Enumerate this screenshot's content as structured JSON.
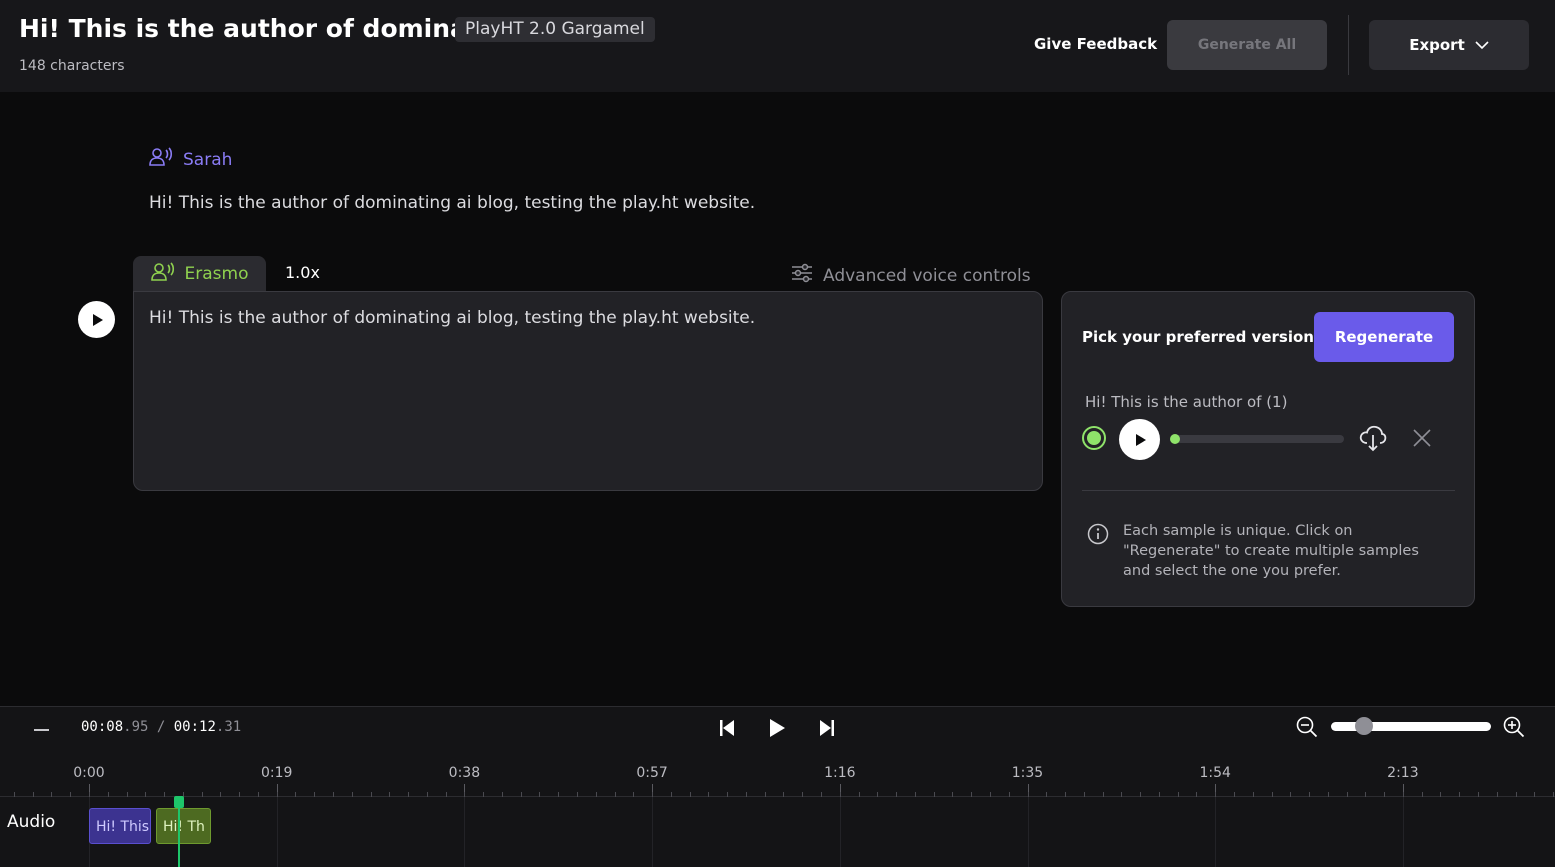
{
  "header": {
    "title": "Hi! This is the author of dominati...",
    "model": "PlayHT 2.0 Gargamel",
    "char_count": "148 characters",
    "feedback": "Give Feedback",
    "generate_all": "Generate All",
    "export": "Export"
  },
  "paragraphs": [
    {
      "speaker": "Sarah",
      "text": "Hi! This is the author of dominating ai blog, testing the play.ht website."
    },
    {
      "speaker": "Erasmo",
      "speed": "1.0x",
      "text": "Hi! This is the author of dominating ai blog, testing the play.ht website."
    }
  ],
  "advanced_controls": "Advanced voice controls",
  "versions": {
    "pick_label": "Pick your preferred version",
    "regenerate": "Regenerate",
    "sample_name": "Hi! This is the author of (1)",
    "sample_progress": 0,
    "info": "Each sample is unique. Click on \"Regenerate\" to create multiple samples and select the one you prefer."
  },
  "player": {
    "current_main": "00:08",
    "current_ms": ".95",
    "separator": " / ",
    "total_main": "00:12",
    "total_ms": ".31",
    "zoom_level": 0.17,
    "ticks": [
      "0:00",
      "0:19",
      "0:38",
      "0:57",
      "1:16",
      "1:35",
      "1:54",
      "2:13"
    ],
    "track_label": "Audio",
    "clips": [
      "Hi! This",
      "Hi! Th"
    ]
  },
  "colors": {
    "accent_purple": "#6a5bea",
    "accent_green": "#8fd14f",
    "playhead": "#1ec66a"
  }
}
